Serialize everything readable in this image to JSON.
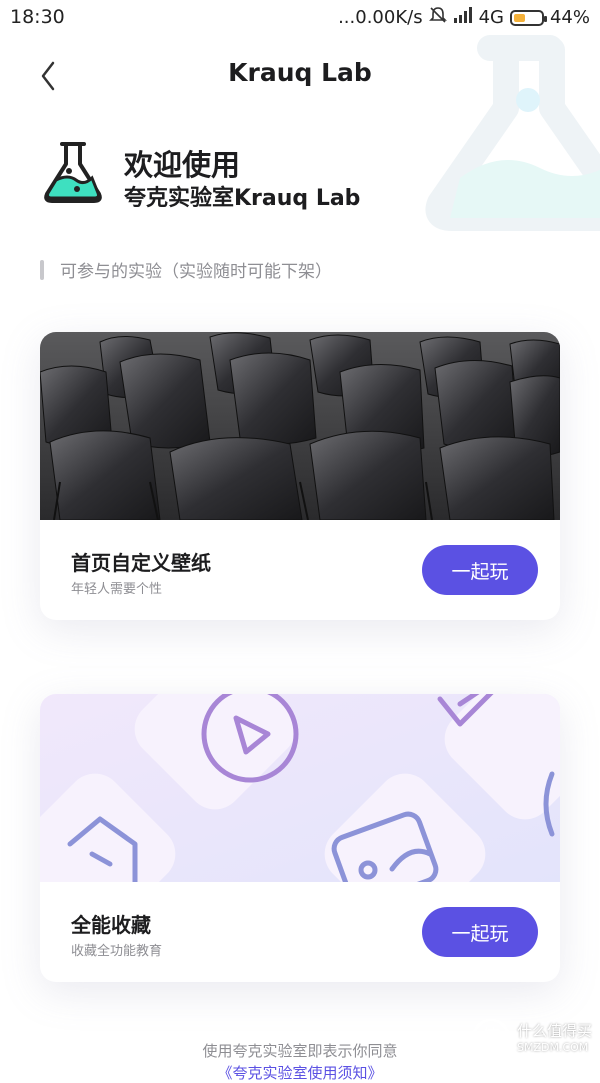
{
  "status_bar": {
    "time": "18:30",
    "network_speed": "...0.00K/s",
    "network_type": "4G",
    "battery": "44%",
    "battery_level": 0.44
  },
  "header": {
    "title": "Krauq Lab"
  },
  "welcome": {
    "line1": "欢迎使用",
    "line2": "夸克实验室Krauq Lab"
  },
  "section": {
    "label": "可参与的实验（实验随时可能下架）"
  },
  "cards": [
    {
      "title": "首页自定义壁纸",
      "subtitle": "年轻人需要个性",
      "button": "一起玩"
    },
    {
      "title": "全能收藏",
      "subtitle": "收藏全功能教育",
      "button": "一起玩"
    }
  ],
  "footer": {
    "text": "使用夸克实验室即表示你同意",
    "link": "《夸克实验室使用须知》"
  },
  "watermark": {
    "text1": "什么值得买",
    "text2": "SMZDM.COM"
  },
  "colors": {
    "accent": "#5b51e3",
    "flask_liquid": "#3ee0c0"
  }
}
